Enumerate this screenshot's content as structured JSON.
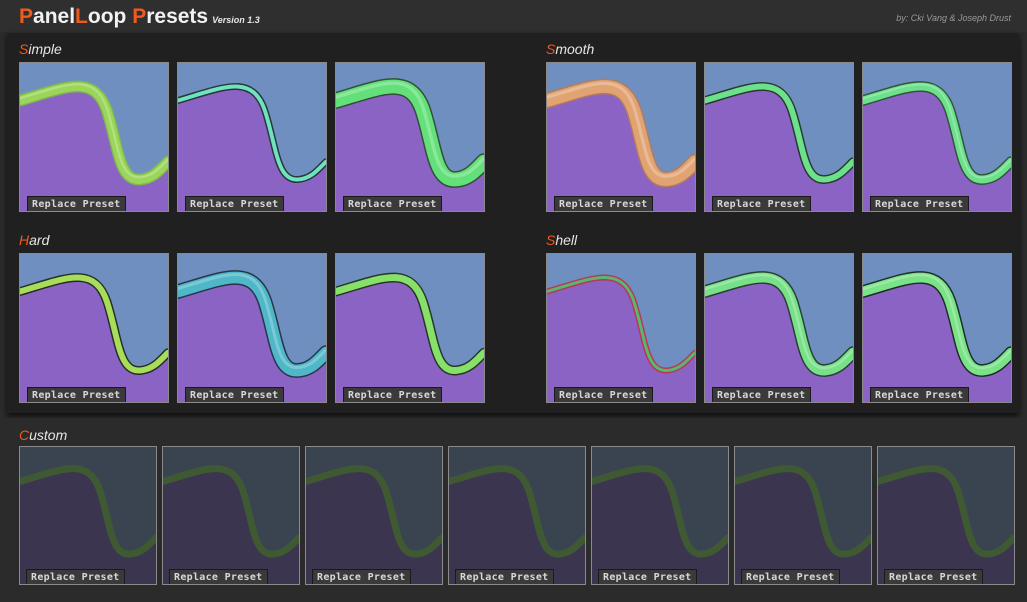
{
  "header": {
    "title_parts": [
      "P",
      "anel",
      "L",
      "oop ",
      "P",
      "resets"
    ],
    "version": "Version 1.3",
    "credits": "by: Cki Vang & Joseph Drust"
  },
  "sections": {
    "simple": {
      "first": "S",
      "rest": "imple"
    },
    "smooth": {
      "first": "S",
      "rest": "mooth"
    },
    "hard": {
      "first": "H",
      "rest": "ard"
    },
    "shell": {
      "first": "S",
      "rest": "hell"
    },
    "custom": {
      "first": "C",
      "rest": "ustom"
    }
  },
  "replace_label": "Replace Preset",
  "colors": {
    "accent": "#f05a1e",
    "sky": "#6f8fc0",
    "ground": "#8a63c4",
    "custom_sky": "#3a4350",
    "custom_ground": "#3b3550",
    "custom_line": "#3f5a33"
  },
  "presets": {
    "simple": [
      {
        "color": "#9bd65a",
        "edge": "#7fbf45",
        "width": 9,
        "glow": false
      },
      {
        "color": "#6fe3c0",
        "edge": "#1f2f2a",
        "width": 4,
        "glow": true
      },
      {
        "color": "#63e07a",
        "edge": "#2b4a2a",
        "width": 14,
        "glow": false
      }
    ],
    "smooth": [
      {
        "color": "#e2a373",
        "edge": "#b57c56",
        "width": 13,
        "glow": false
      },
      {
        "color": "#6ce08a",
        "edge": "#1d3320",
        "width": 6,
        "glow": false
      },
      {
        "color": "#6ce08a",
        "edge": "#2a4f30",
        "width": 8,
        "glow": false
      }
    ],
    "hard": [
      {
        "color": "#a7dd5a",
        "edge": "#1c2515",
        "width": 6,
        "glow": false
      },
      {
        "color": "#4fb7c8",
        "edge": "#1d2f3b",
        "width": 12,
        "glow": false
      },
      {
        "color": "#86e06a",
        "edge": "#1f2d17",
        "width": 7,
        "glow": false
      }
    ],
    "shell": [
      {
        "color": "#58b870",
        "edge": "#c0304a",
        "width": 3,
        "glow": false
      },
      {
        "color": "#78e088",
        "edge": "#1d3a22",
        "width": 10,
        "glow": false
      },
      {
        "color": "#7ae287",
        "edge": "#142417",
        "width": 10,
        "glow": false
      }
    ]
  },
  "custom_count": 7
}
